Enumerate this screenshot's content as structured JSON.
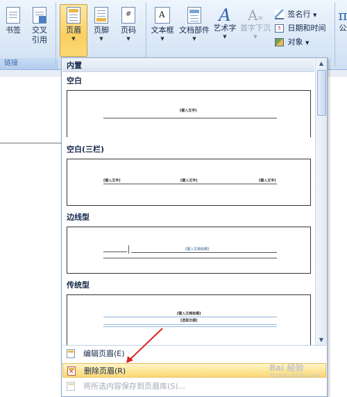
{
  "ribbon": {
    "bookmark": "书签",
    "cross_ref_line1": "交叉",
    "cross_ref_line2": "引用",
    "header": "页眉",
    "footer": "页脚",
    "page_number": "页码",
    "text_box": "文本框",
    "doc_parts": "文档部件",
    "wordart": "艺术字",
    "drop_cap": "首字下沉",
    "signature_line": "签名行",
    "date_time": "日期和时间",
    "object": "对象",
    "links_group": "链接",
    "right_cut_label": "公"
  },
  "gallery": {
    "builtin_label": "内置",
    "sections": [
      {
        "title": "空白",
        "placeholders": [
          "[键入文字]"
        ]
      },
      {
        "title": "空白(三栏)",
        "placeholders": [
          "[键入文字]",
          "[键入文字]",
          "[键入文字]"
        ]
      },
      {
        "title": "边线型",
        "placeholders": [
          "[键入文档标题]"
        ]
      },
      {
        "title": "传统型",
        "placeholders": [
          "[键入文档标题]",
          "[选取日期]"
        ]
      }
    ]
  },
  "menu": {
    "edit_header": "编辑页眉(E)",
    "remove_header": "删除页眉(R)",
    "save_selection": "将所选内容保存到页眉库(S)..."
  },
  "watermark": {
    "brand": "Bai 经验",
    "url": "jingyan.baidu.com"
  },
  "colors": {
    "active_button": "#fbcf62",
    "hover_item": "#fde79a",
    "annotation_arrow": "#d9231f",
    "ribbon_bg": "#dde9f7"
  }
}
